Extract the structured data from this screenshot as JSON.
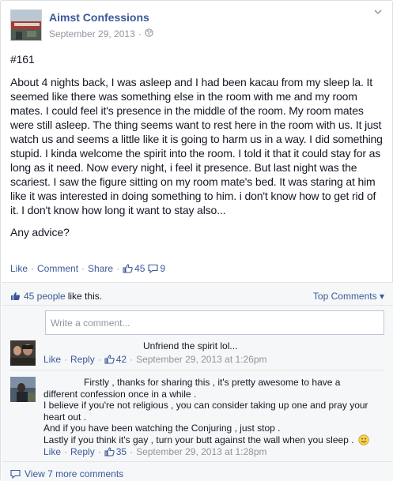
{
  "post": {
    "page_name": "Aimst Confessions",
    "date": "September 29, 2013",
    "meta_dot": "·",
    "number": "#161",
    "body": "About 4 nights back, I was asleep and I had been kacau from my sleep la. It seemed like there was something else in the room with me and my room mates. I could feel it's presence in the middle of the room. My room mates were still asleep. The thing seems want to rest here in the room with us. It just watch us and seems a little like it is going to harm us in a way. I did something stupid. I kinda welcome the spirit into the room. I told it that it could stay for as long as it need. Now every night, i feel it presence. But last night was the scariest. I saw the figure sitting on my room mate's bed. It was staring at him like it was interested in doing something to him. i don't know how to get rid of it. I don't know how long it want to stay also...",
    "closing": "Any advice?"
  },
  "actions": {
    "like": "Like",
    "comment": "Comment",
    "share": "Share",
    "separator": "·",
    "likes": "45",
    "comments": "9"
  },
  "ufi": {
    "likes_count": "45 people",
    "likes_suffix": "like this.",
    "top_comments": "Top Comments",
    "top_comments_arrow": "▾",
    "comment_placeholder": "Write a comment...",
    "view_more": "View 7 more comments"
  },
  "comments": [
    {
      "text_lines": [
        "Unfriend the spirit lol..."
      ],
      "like": "Like",
      "reply": "Reply",
      "likes": "42",
      "time": "September 29, 2013 at 1:26pm"
    },
    {
      "text_lines": [
        "Firstly , thanks for sharing this , it's pretty awesome to have a",
        "different confession once in a while .",
        "I believe if you're not religious , you can consider taking up one and pray your",
        "heart out .",
        "And if you have been watching the Conjuring , just stop .",
        "Lastly if you think it's gay , turn your butt against the wall when you sleep ."
      ],
      "like": "Like",
      "reply": "Reply",
      "likes": "35",
      "time": "September 29, 2013 at 1:28pm"
    }
  ],
  "colors": {
    "link": "#3b5998",
    "meta": "#90949c",
    "ufi_bg": "#f6f7f9",
    "text": "#141823"
  },
  "icons": {
    "globe": "globe-icon",
    "chevron": "chevron-down-icon",
    "like": "thumbs-up-icon",
    "comment": "comment-bubble-icon",
    "view_more": "comment-bubble-icon",
    "smiley": "smiley-emoticon-icon"
  }
}
